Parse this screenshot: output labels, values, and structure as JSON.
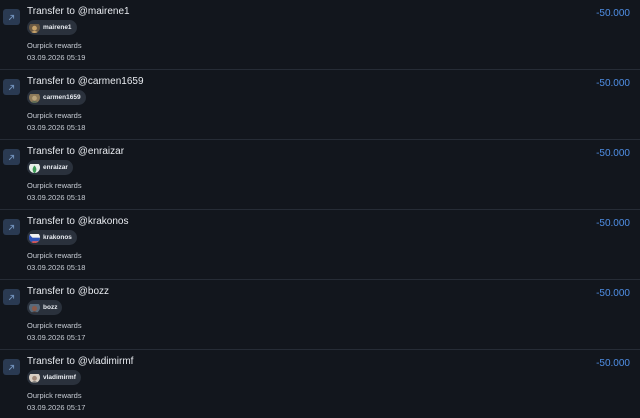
{
  "colors": {
    "background": "#12161d",
    "amount": "#4f8fe6",
    "icon_bg": "#2a3a52",
    "chip_bg": "#2a313c",
    "divider": "#262c36"
  },
  "transactions": [
    {
      "title": "Transfer to @mairene1",
      "user": "mairene1",
      "note": "Ourpick rewards",
      "date": "03.09.2026 05:19",
      "amount": "-50.000",
      "avatar_color": "#c9a46b",
      "icon": "arrow-up-right-icon"
    },
    {
      "title": "Transfer to @carmen1659",
      "user": "carmen1659",
      "note": "Ourpick rewards",
      "date": "03.09.2026 05:18",
      "amount": "-50.000",
      "avatar_color": "#b9a37a",
      "icon": "arrow-up-right-icon"
    },
    {
      "title": "Transfer to @enraizar",
      "user": "enraizar",
      "note": "Ourpick rewards",
      "date": "03.09.2026 05:18",
      "amount": "-50.000",
      "avatar_color": "#3e9a57",
      "icon": "arrow-up-right-icon"
    },
    {
      "title": "Transfer to @krakonos",
      "user": "krakonos",
      "note": "Ourpick rewards",
      "date": "03.09.2026 05:18",
      "amount": "-50.000",
      "avatar_color": "#d64545",
      "icon": "arrow-up-right-icon"
    },
    {
      "title": "Transfer to @bozz",
      "user": "bozz",
      "note": "Ourpick rewards",
      "date": "03.09.2026 05:17",
      "amount": "-50.000",
      "avatar_color": "#8a5a4a",
      "icon": "arrow-up-right-icon"
    },
    {
      "title": "Transfer to @vladimirmf",
      "user": "vladimirmf",
      "note": "Ourpick rewards",
      "date": "03.09.2026 05:17",
      "amount": "-50.000",
      "avatar_color": "#d8cfc4",
      "icon": "arrow-up-right-icon"
    }
  ]
}
